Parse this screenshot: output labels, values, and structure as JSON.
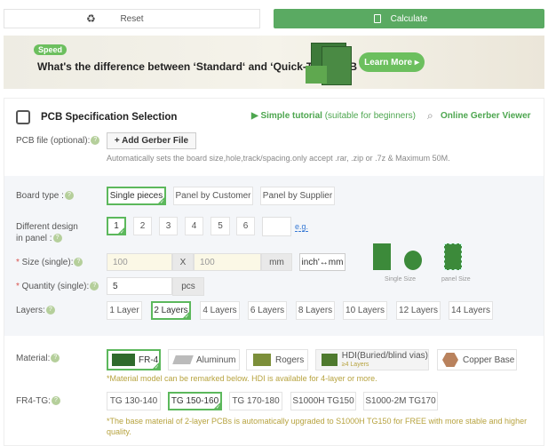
{
  "toolbar": {
    "reset": "Reset",
    "calculate": "Calculate"
  },
  "banner": {
    "badge": "Speed",
    "title": "What's the difference between ‘Standard‘ and ‘Quick-Turn’ PCB",
    "cta": "Learn More ▸"
  },
  "spec": {
    "title": "PCB Specification Selection",
    "tutorial": "▶ Simple tutorial",
    "tutorial_note": " (suitable for beginners)",
    "gerber_viewer": "Online Gerber Viewer"
  },
  "pcb_file": {
    "label": "PCB file (optional):",
    "button": "+ Add Gerber File",
    "hint": "Automatically sets the board size,hole,track/spacing.only accept .rar, .zip or .7z & Maximum 50M."
  },
  "board_type": {
    "label": "Board type :",
    "options": [
      "Single pieces",
      "Panel by Customer",
      "Panel by Supplier"
    ],
    "selected": 0
  },
  "design": {
    "label1": "Different design",
    "label2": "in panel :",
    "options": [
      "1",
      "2",
      "3",
      "4",
      "5",
      "6"
    ],
    "selected": 0,
    "custom": "",
    "eg": "e.g."
  },
  "size": {
    "label": "Size (single):",
    "width": "100",
    "x": "X",
    "height": "100",
    "unit": "mm",
    "toggle": "inch'↔mm",
    "single_caption": "Single Size",
    "panel_caption": "panel Size"
  },
  "quantity": {
    "label": "Quantity (single):",
    "value": "5",
    "unit": "pcs"
  },
  "layers": {
    "label": "Layers:",
    "options": [
      "1 Layer",
      "2 Layers",
      "4 Layers",
      "6 Layers",
      "8 Layers",
      "10 Layers",
      "12 Layers",
      "14 Layers"
    ],
    "selected": 1
  },
  "material": {
    "label": "Material:",
    "options": [
      "FR-4",
      "Aluminum",
      "Rogers",
      "HDI(Buried/blind vias)",
      "Copper Base"
    ],
    "hdi_sub": "≥4 Layers",
    "selected": 0,
    "note": "*Material model can be remarked below. HDI is available for 4-layer or more."
  },
  "tg": {
    "label": "FR4-TG:",
    "options": [
      "TG 130-140",
      "TG 150-160",
      "TG 170-180",
      "S1000H TG150",
      "S1000-2M TG170"
    ],
    "selected": 1,
    "note1": "*The base material of 2-layer PCBs is automatically upgraded to S1000H TG150 for FREE with more stable and higher",
    "note2": "quality."
  },
  "colors": {
    "accent": "#5aaa62",
    "note": "#b7a33f"
  }
}
